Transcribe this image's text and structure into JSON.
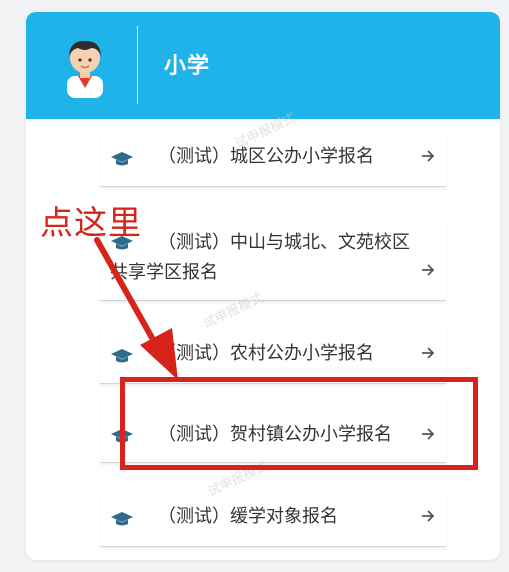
{
  "header": {
    "title": "小学"
  },
  "items": [
    {
      "prefix": "（测试）",
      "label": "城区公办小学报名",
      "icon": "graduation-cap-icon"
    },
    {
      "prefix": "（测试）",
      "label_line1": "中山与城北、文苑校区",
      "label_line2": "共享学区报名",
      "icon": "graduation-cap-icon"
    },
    {
      "prefix": "（测试）",
      "label": "农村公办小学报名",
      "icon": "graduation-cap-icon"
    },
    {
      "prefix": "（测试）",
      "label": "贺村镇公办小学报名",
      "icon": "graduation-cap-icon"
    },
    {
      "prefix": "（测试）",
      "label": "缓学对象报名",
      "icon": "graduation-cap-icon"
    }
  ],
  "watermark": "试申报模式",
  "annotation": {
    "text": "点这里",
    "color": "#d6241a"
  },
  "colors": {
    "header": "#1fb3ea",
    "icon": "#2e6a8a",
    "annotation": "#d6241a"
  }
}
